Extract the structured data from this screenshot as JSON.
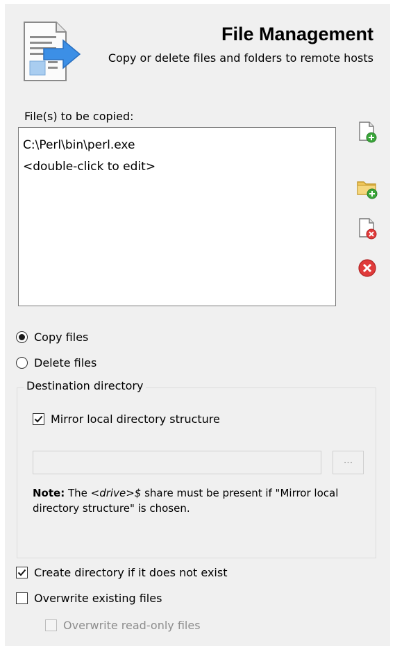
{
  "header": {
    "title": "File Management",
    "subtitle": "Copy or delete files and folders to remote hosts",
    "icon": "file-transfer-icon"
  },
  "files_section": {
    "label": "File(s) to be copied:",
    "items": [
      "C:\\Perl\\bin\\perl.exe",
      "<double-click to edit>"
    ]
  },
  "side_buttons": [
    {
      "icon": "add-file-icon"
    },
    {
      "icon": "add-folder-icon"
    },
    {
      "icon": "remove-file-icon"
    },
    {
      "icon": "remove-all-icon"
    }
  ],
  "operation": {
    "copy_label": "Copy files",
    "delete_label": "Delete files",
    "selected": "copy"
  },
  "destination": {
    "group_label": "Destination directory",
    "mirror_label": "Mirror local directory structure",
    "mirror_checked": true,
    "path_value": "",
    "browse_label": "...",
    "note_bold": "Note:",
    "note_text_1": "The",
    "note_drive": "<drive>$",
    "note_text_2": "share must be present if \"Mirror local directory structure\" is chosen."
  },
  "options": {
    "create_dir_label": "Create directory if it does not exist",
    "create_dir_checked": true,
    "overwrite_label": "Overwrite existing files",
    "overwrite_checked": false,
    "overwrite_readonly_label": "Overwrite read-only files",
    "overwrite_readonly_checked": false,
    "overwrite_readonly_enabled": false
  },
  "colors": {
    "panel_bg": "#f0f0f0",
    "add_green": "#3aa63a",
    "remove_red": "#e03b3b",
    "accent_blue": "#3c8fe6"
  }
}
